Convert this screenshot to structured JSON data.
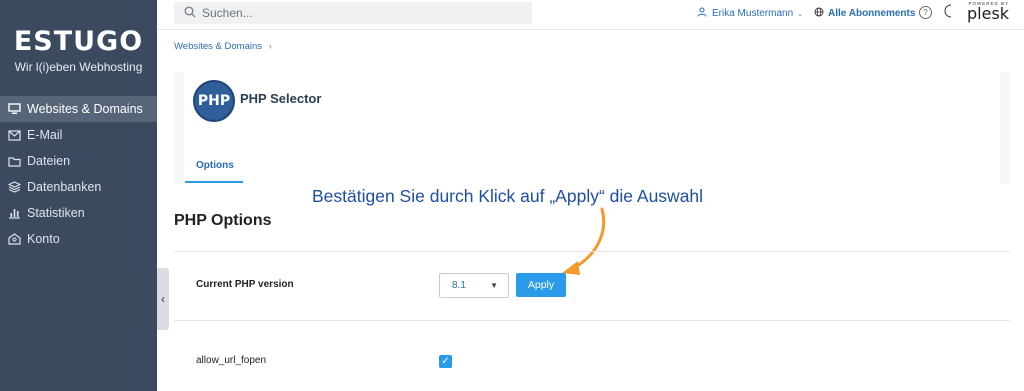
{
  "brand": {
    "logo": "ESTUGO",
    "tagline": "Wir l(i)eben Webhosting"
  },
  "sidebar": {
    "items": [
      {
        "label": "Websites & Domains",
        "icon": "monitor-icon",
        "active": true
      },
      {
        "label": "E-Mail",
        "icon": "mail-icon"
      },
      {
        "label": "Dateien",
        "icon": "folder-icon"
      },
      {
        "label": "Datenbanken",
        "icon": "database-icon"
      },
      {
        "label": "Statistiken",
        "icon": "bar-chart-icon"
      },
      {
        "label": "Konto",
        "icon": "account-icon"
      }
    ]
  },
  "topbar": {
    "search_placeholder": "Suchen...",
    "user": "Erika Mustermann",
    "subscriptions": "Alle Abonnements",
    "help": "?",
    "powered_by": "POWERED BY",
    "plesk": "plesk"
  },
  "breadcrumb": "Websites & Domains",
  "header": {
    "logo": "PHP",
    "title": "PHP Selector",
    "tab": "Options"
  },
  "annotation": "Bestätigen Sie durch Klick auf „Apply“ die Auswahl",
  "options": {
    "title": "PHP Options",
    "current_label": "Current PHP version",
    "current_value": "8.1",
    "apply_label": "Apply",
    "allow_url_label": "allow_url_fopen",
    "allow_url_checked": true
  },
  "colors": {
    "sidebar": "#3b4a5e",
    "accent": "#2a9be8",
    "link": "#2a6db5",
    "annotation": "#1f4fa5",
    "arrow": "#f39a2b"
  }
}
